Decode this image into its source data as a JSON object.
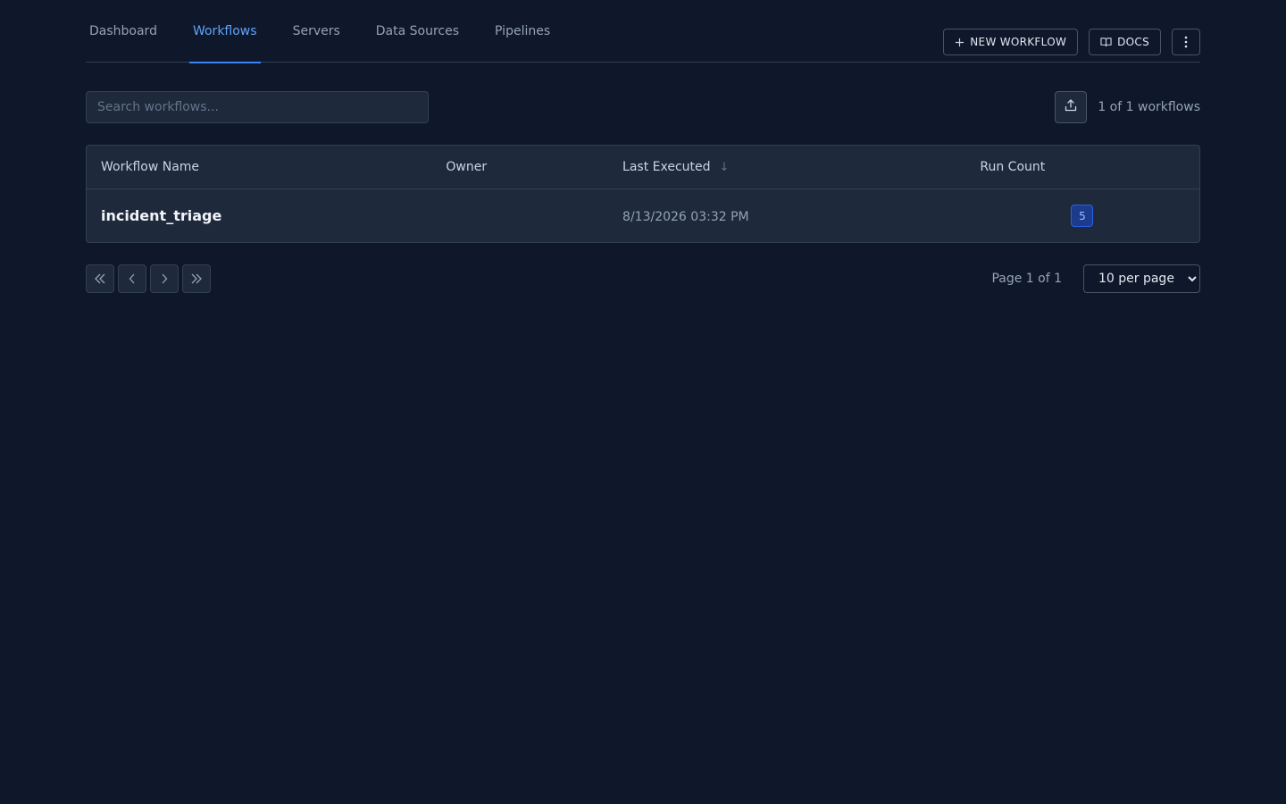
{
  "nav": {
    "tabs": [
      {
        "label": "Dashboard",
        "active": false
      },
      {
        "label": "Workflows",
        "active": true
      },
      {
        "label": "Servers",
        "active": false
      },
      {
        "label": "Data Sources",
        "active": false
      },
      {
        "label": "Pipelines",
        "active": false
      }
    ],
    "new_workflow_label": "NEW WORKFLOW",
    "new_workflow_icon": "plus-icon",
    "docs_label": "DOCS",
    "docs_icon": "book-icon",
    "more_icon": "more-vertical-icon"
  },
  "toolbar": {
    "search_placeholder": "Search workflows...",
    "search_value": "",
    "export_icon": "upload-icon",
    "count_text": "1 of 1 workflows"
  },
  "table": {
    "columns": [
      "Workflow Name",
      "Owner",
      "Last Executed",
      "Run Count"
    ],
    "sort_column": "Last Executed",
    "sort_direction": "desc",
    "sort_indicator": "↓",
    "rows": [
      {
        "name": "incident_triage",
        "owner": "",
        "last_executed": "8/13/2026 03:32 PM",
        "run_count": "5"
      }
    ]
  },
  "pagination": {
    "page_info": "Page 1 of 1",
    "per_page_options": [
      "10 per page"
    ],
    "per_page_selected": "10 per page"
  },
  "colors": {
    "background": "#0f172a",
    "surface": "#1e293b",
    "accent": "#3b82f6",
    "badge_bg": "#1e3a8a"
  }
}
